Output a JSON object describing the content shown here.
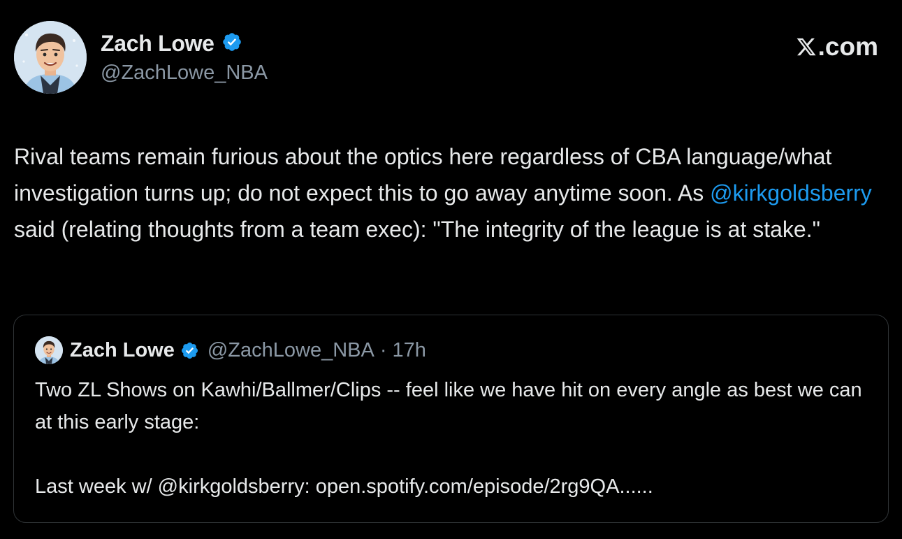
{
  "author": {
    "display_name": "Zach Lowe",
    "handle": "@ZachLowe_NBA",
    "verified": true
  },
  "brand": {
    "label": ".com"
  },
  "tweet": {
    "text_part1": "Rival teams remain furious about the optics here regardless of CBA language/what investigation turns up; do not expect this to go away anytime soon. As ",
    "mention": "@kirkgoldsberry",
    "text_part2": " said (relating thoughts from a team exec): \"The integrity of the league is at stake.\""
  },
  "quoted_tweet": {
    "display_name": "Zach Lowe",
    "handle": "@ZachLowe_NBA",
    "separator": "·",
    "time": "17h",
    "line1": "Two ZL Shows on Kawhi/Ballmer/Clips -- feel like we have hit on every angle as best we can at this early stage:",
    "line2": "",
    "line3": "Last week w/ @kirkgoldsberry: open.spotify.com/episode/2rg9QA......"
  },
  "colors": {
    "background": "#000000",
    "text": "#e7e9ea",
    "secondary": "#8b98a5",
    "link": "#1d9bf0",
    "verified": "#1d9bf0",
    "border": "#2f3336"
  }
}
